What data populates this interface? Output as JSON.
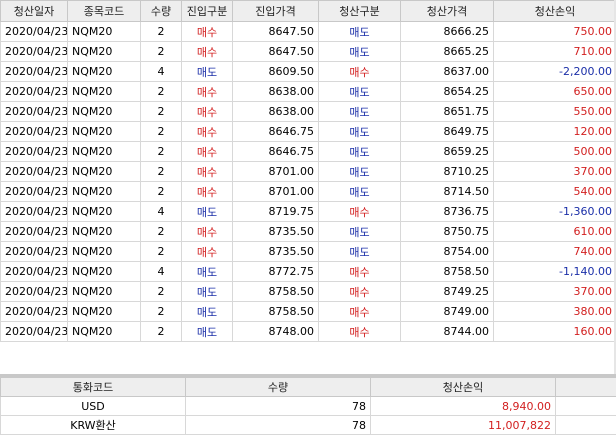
{
  "columns": [
    "청산일자",
    "종목코드",
    "수량",
    "진입구분",
    "진입가격",
    "청산구분",
    "청산가격",
    "청산손익"
  ],
  "rows": [
    {
      "date": "2020/04/23",
      "code": "NQM20",
      "qty": "2",
      "entry_side": "매수",
      "entry_price": "8647.50",
      "exit_side": "매도",
      "exit_price": "8666.25",
      "pnl": "750.00",
      "pnl_sign": "pos",
      "entry_type": "buy",
      "exit_type": "sell"
    },
    {
      "date": "2020/04/23",
      "code": "NQM20",
      "qty": "2",
      "entry_side": "매수",
      "entry_price": "8647.50",
      "exit_side": "매도",
      "exit_price": "8665.25",
      "pnl": "710.00",
      "pnl_sign": "pos",
      "entry_type": "buy",
      "exit_type": "sell"
    },
    {
      "date": "2020/04/23",
      "code": "NQM20",
      "qty": "4",
      "entry_side": "매도",
      "entry_price": "8609.50",
      "exit_side": "매수",
      "exit_price": "8637.00",
      "pnl": "-2,200.00",
      "pnl_sign": "neg",
      "entry_type": "sell",
      "exit_type": "buy"
    },
    {
      "date": "2020/04/23",
      "code": "NQM20",
      "qty": "2",
      "entry_side": "매수",
      "entry_price": "8638.00",
      "exit_side": "매도",
      "exit_price": "8654.25",
      "pnl": "650.00",
      "pnl_sign": "pos",
      "entry_type": "buy",
      "exit_type": "sell"
    },
    {
      "date": "2020/04/23",
      "code": "NQM20",
      "qty": "2",
      "entry_side": "매수",
      "entry_price": "8638.00",
      "exit_side": "매도",
      "exit_price": "8651.75",
      "pnl": "550.00",
      "pnl_sign": "pos",
      "entry_type": "buy",
      "exit_type": "sell"
    },
    {
      "date": "2020/04/23",
      "code": "NQM20",
      "qty": "2",
      "entry_side": "매수",
      "entry_price": "8646.75",
      "exit_side": "매도",
      "exit_price": "8649.75",
      "pnl": "120.00",
      "pnl_sign": "pos",
      "entry_type": "buy",
      "exit_type": "sell"
    },
    {
      "date": "2020/04/23",
      "code": "NQM20",
      "qty": "2",
      "entry_side": "매수",
      "entry_price": "8646.75",
      "exit_side": "매도",
      "exit_price": "8659.25",
      "pnl": "500.00",
      "pnl_sign": "pos",
      "entry_type": "buy",
      "exit_type": "sell"
    },
    {
      "date": "2020/04/23",
      "code": "NQM20",
      "qty": "2",
      "entry_side": "매수",
      "entry_price": "8701.00",
      "exit_side": "매도",
      "exit_price": "8710.25",
      "pnl": "370.00",
      "pnl_sign": "pos",
      "entry_type": "buy",
      "exit_type": "sell"
    },
    {
      "date": "2020/04/23",
      "code": "NQM20",
      "qty": "2",
      "entry_side": "매수",
      "entry_price": "8701.00",
      "exit_side": "매도",
      "exit_price": "8714.50",
      "pnl": "540.00",
      "pnl_sign": "pos",
      "entry_type": "buy",
      "exit_type": "sell"
    },
    {
      "date": "2020/04/23",
      "code": "NQM20",
      "qty": "4",
      "entry_side": "매도",
      "entry_price": "8719.75",
      "exit_side": "매수",
      "exit_price": "8736.75",
      "pnl": "-1,360.00",
      "pnl_sign": "neg",
      "entry_type": "sell",
      "exit_type": "buy"
    },
    {
      "date": "2020/04/23",
      "code": "NQM20",
      "qty": "2",
      "entry_side": "매수",
      "entry_price": "8735.50",
      "exit_side": "매도",
      "exit_price": "8750.75",
      "pnl": "610.00",
      "pnl_sign": "pos",
      "entry_type": "buy",
      "exit_type": "sell"
    },
    {
      "date": "2020/04/23",
      "code": "NQM20",
      "qty": "2",
      "entry_side": "매수",
      "entry_price": "8735.50",
      "exit_side": "매도",
      "exit_price": "8754.00",
      "pnl": "740.00",
      "pnl_sign": "pos",
      "entry_type": "buy",
      "exit_type": "sell"
    },
    {
      "date": "2020/04/23",
      "code": "NQM20",
      "qty": "4",
      "entry_side": "매도",
      "entry_price": "8772.75",
      "exit_side": "매수",
      "exit_price": "8758.50",
      "pnl": "-1,140.00",
      "pnl_sign": "neg",
      "entry_type": "sell",
      "exit_type": "buy"
    },
    {
      "date": "2020/04/23",
      "code": "NQM20",
      "qty": "2",
      "entry_side": "매도",
      "entry_price": "8758.50",
      "exit_side": "매수",
      "exit_price": "8749.25",
      "pnl": "370.00",
      "pnl_sign": "pos",
      "entry_type": "sell",
      "exit_type": "buy"
    },
    {
      "date": "2020/04/23",
      "code": "NQM20",
      "qty": "2",
      "entry_side": "매도",
      "entry_price": "8758.50",
      "exit_side": "매수",
      "exit_price": "8749.00",
      "pnl": "380.00",
      "pnl_sign": "pos",
      "entry_type": "sell",
      "exit_type": "buy"
    },
    {
      "date": "2020/04/23",
      "code": "NQM20",
      "qty": "2",
      "entry_side": "매도",
      "entry_price": "8748.00",
      "exit_side": "매수",
      "exit_price": "8744.00",
      "pnl": "160.00",
      "pnl_sign": "pos",
      "entry_type": "sell",
      "exit_type": "buy"
    }
  ],
  "summary": {
    "columns": [
      "통화코드",
      "수량",
      "청산손익"
    ],
    "rows": [
      {
        "currency": "USD",
        "qty": "78",
        "pnl": "8,940.00"
      },
      {
        "currency": "KRW환산",
        "qty": "78",
        "pnl": "11,007,822"
      }
    ]
  }
}
